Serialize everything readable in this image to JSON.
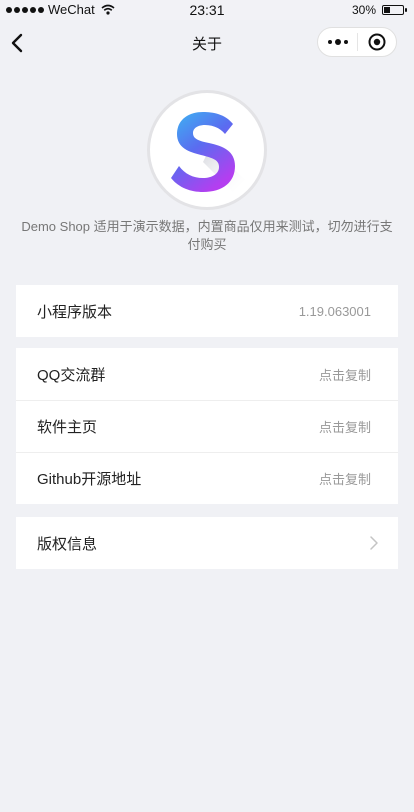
{
  "status_bar": {
    "carrier": "WeChat",
    "time": "23:31",
    "battery_percent": "30%",
    "battery_level": 0.3
  },
  "nav": {
    "title": "关于",
    "back_icon": "chevron-left-icon",
    "more_icon": "more-dots-icon",
    "close_icon": "target-circle-icon"
  },
  "logo": {
    "letter": "S",
    "colors": [
      "#3bb7f2",
      "#5a6cf0",
      "#b43ef0"
    ]
  },
  "description": "Demo Shop 适用于演示数据，内置商品仅用来测试，切勿进行支付购买",
  "version_card": {
    "label": "小程序版本",
    "value": "1.19.063001"
  },
  "links_card": {
    "items": [
      {
        "label": "QQ交流群",
        "action": "点击复制"
      },
      {
        "label": "软件主页",
        "action": "点击复制"
      },
      {
        "label": "Github开源地址",
        "action": "点击复制"
      }
    ]
  },
  "copyright_card": {
    "label": "版权信息",
    "icon": "chevron-right-icon"
  }
}
